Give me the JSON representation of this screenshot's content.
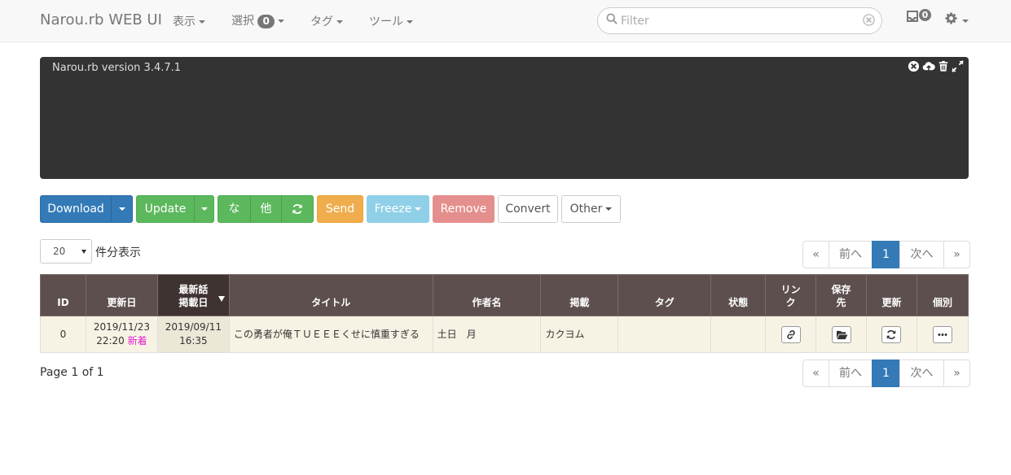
{
  "navbar": {
    "brand": "Narou.rb WEB UI",
    "menu_view": "表示",
    "menu_select": "選択",
    "select_count": "0",
    "menu_tag": "タグ",
    "menu_tool": "ツール",
    "filter_placeholder": "Filter",
    "inbox_count": "0"
  },
  "console": {
    "text": "Narou.rb version 3.4.7.1"
  },
  "toolbar": {
    "download": "Download",
    "update": "Update",
    "na": "な",
    "other_jp": "他",
    "send": "Send",
    "freeze": "Freeze",
    "remove": "Remove",
    "convert": "Convert",
    "other": "Other"
  },
  "per_page": {
    "value": "20",
    "label": "件分表示"
  },
  "pagination": {
    "first": "«",
    "prev": "前へ",
    "current": "1",
    "next": "次へ",
    "last": "»"
  },
  "table": {
    "headers": {
      "id": "ID",
      "updated": "更新日",
      "latest_line1": "最新話",
      "latest_line2": "掲載日",
      "title": "タイトル",
      "author": "作者名",
      "site": "掲載",
      "tags": "タグ",
      "status": "状態",
      "link_line1": "リン",
      "link_line2": "ク",
      "save_line1": "保存",
      "save_line2": "先",
      "update": "更新",
      "individual": "個別"
    },
    "rows": [
      {
        "id": "0",
        "updated_date": "2019/11/23",
        "updated_time": "22:20",
        "new_label": "新着",
        "latest_date": "2019/09/11",
        "latest_time": "16:35",
        "title": "この勇者が俺ＴＵＥＥＥくせに慎重すぎる",
        "author": "土日　月",
        "site": "カクヨム",
        "tags": "",
        "status": ""
      }
    ]
  },
  "page_info": "Page 1 of 1",
  "colors": {
    "primary": "#337ab7",
    "success": "#5cb85c",
    "warning": "#f0ad4e",
    "info": "#8fd0e8",
    "danger": "#e48f8d",
    "table_header": "#5c4f4d",
    "row_bg": "#f7f3e4",
    "new_label": "#e020d0"
  }
}
